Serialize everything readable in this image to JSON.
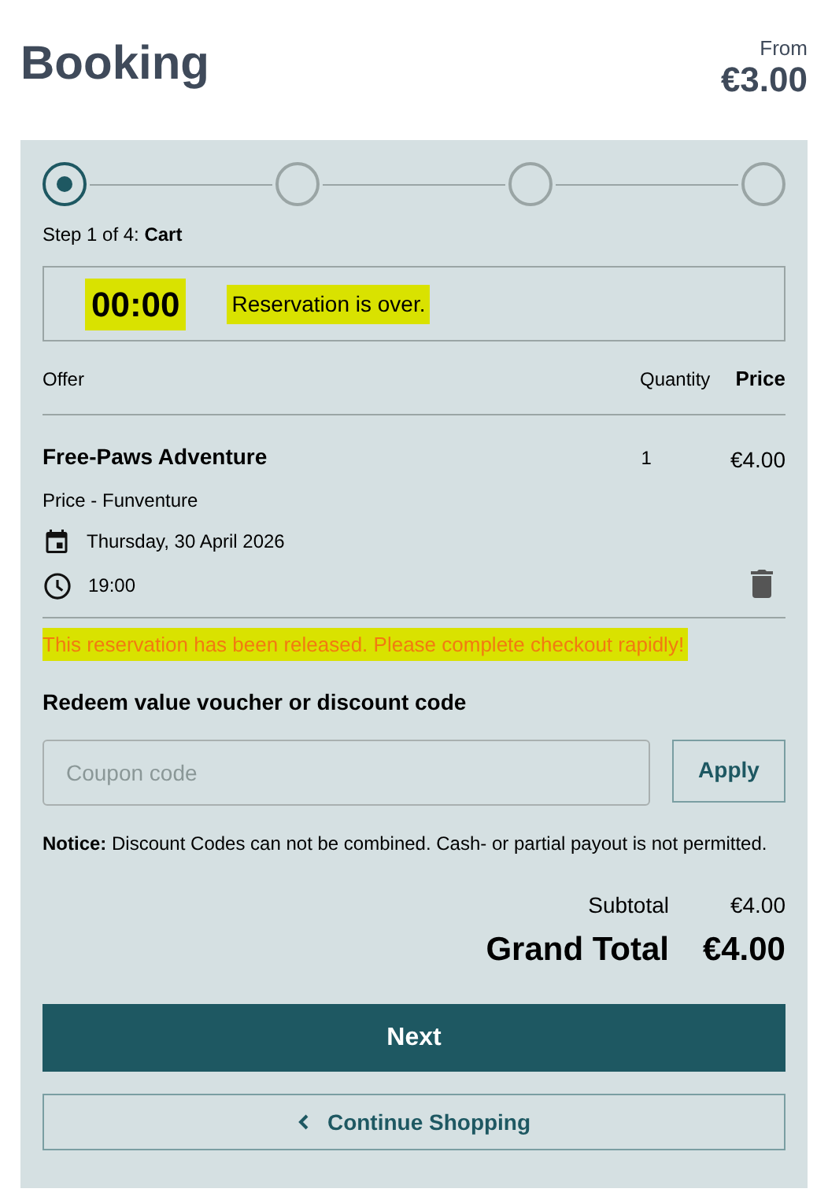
{
  "header": {
    "title": "Booking",
    "price_prefix": "From",
    "price": "€3.00"
  },
  "steps": [
    {
      "selected": true
    },
    {
      "selected": false
    },
    {
      "selected": false
    },
    {
      "selected": false
    }
  ],
  "step_label": "Step 1 of 4: **Cart**",
  "timer": {
    "time": "00:00",
    "message": "Reservation is over.",
    "highlighted": true
  },
  "table": {
    "columns": [
      "Offer",
      "Quantity",
      "Price"
    ],
    "rows": [
      {
        "offer": "Free-Paws Adventure",
        "price_type": "Price - Funventure",
        "date": "Thursday, 30 April 2026",
        "time": "19:00",
        "quantity": "1",
        "price": "€4.00"
      }
    ]
  },
  "warning": {
    "text": "This reservation has been released. Please complete checkout rapidly!",
    "highlighted": true
  },
  "voucher": {
    "heading": "Redeem value voucher or discount code",
    "placeholder": "Coupon code",
    "button": "Apply"
  },
  "notice": "**Notice:** Discount Codes can not be combined. Cash- or partial payout is not permitted.",
  "totals": {
    "subtotal_label": "Subtotal",
    "subtotal": "€4.00",
    "grand_label": "Grand Total",
    "grand": "€4.00"
  },
  "buttons": {
    "next": "Next",
    "continue": "Continue Shopping"
  }
}
